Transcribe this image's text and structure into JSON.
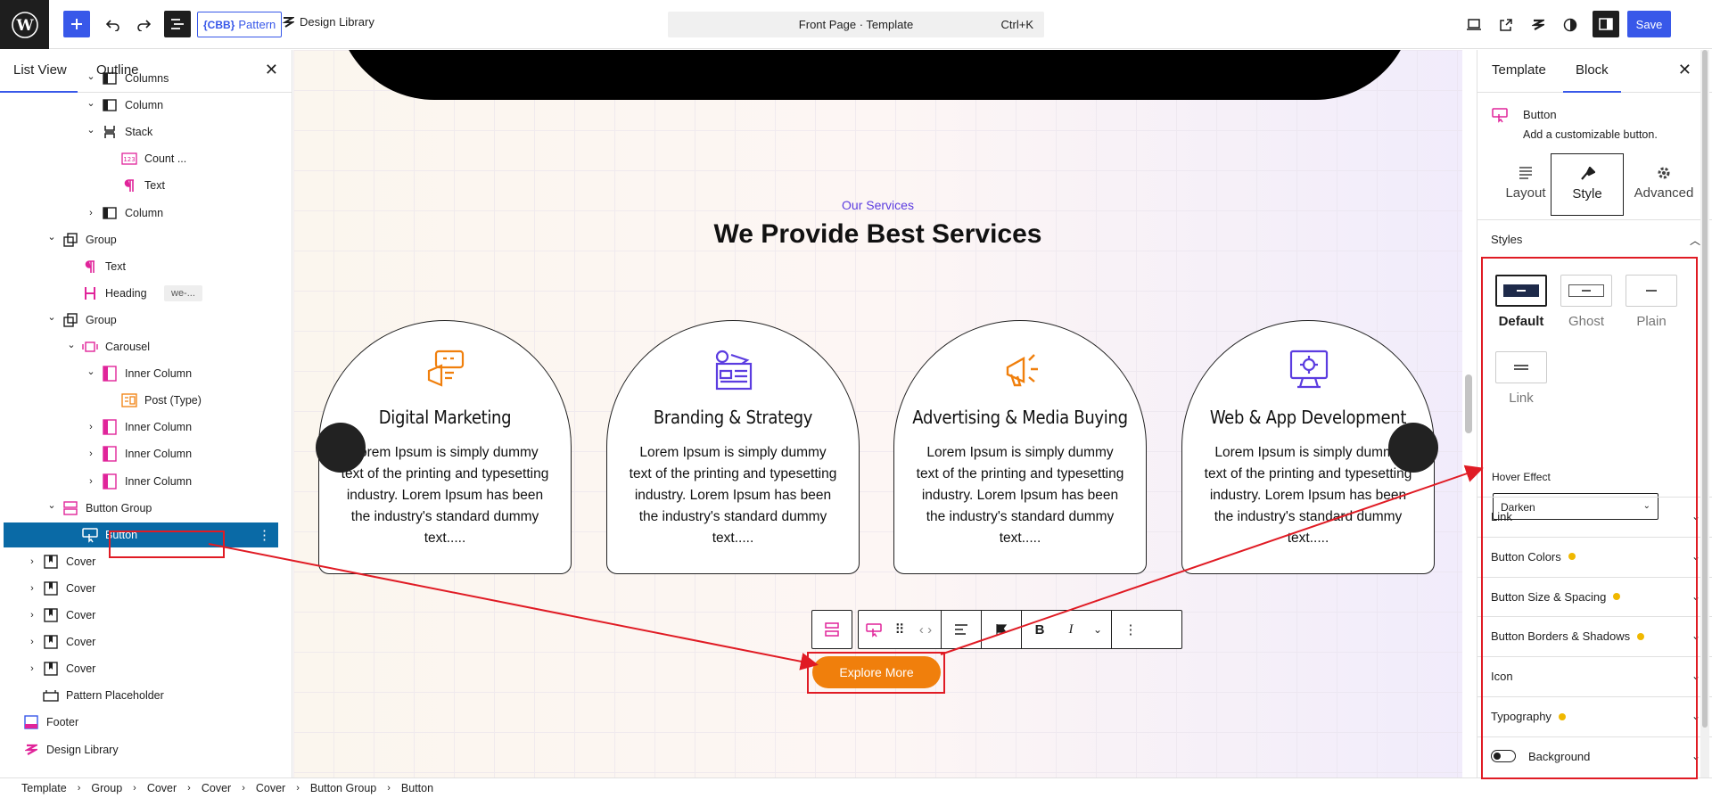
{
  "topbar": {
    "pattern_badge": "{CBB}",
    "pattern_label": "Pattern",
    "design_library": "Design Library",
    "command_title": "Front Page · Template",
    "command_shortcut": "Ctrl+K",
    "save_label": "Save"
  },
  "list_panel": {
    "tabs": [
      "List View",
      "Outline"
    ],
    "items": [
      {
        "label": "Columns",
        "chevron": "down"
      },
      {
        "label": "Column",
        "chevron": "down"
      },
      {
        "label": "Stack",
        "chevron": "down"
      },
      {
        "label": "Count ...",
        "chevron": ""
      },
      {
        "label": "Text",
        "chevron": ""
      },
      {
        "label": "Column",
        "chevron": "right"
      },
      {
        "label": "Group",
        "chevron": "down"
      },
      {
        "label": "Text",
        "chevron": ""
      },
      {
        "label": "Heading",
        "chevron": "",
        "badge": "we-..."
      },
      {
        "label": "Group",
        "chevron": "down"
      },
      {
        "label": "Carousel",
        "chevron": "down"
      },
      {
        "label": "Inner Column",
        "chevron": "down"
      },
      {
        "label": "Post (Type)",
        "chevron": ""
      },
      {
        "label": "Inner Column",
        "chevron": "right"
      },
      {
        "label": "Inner Column",
        "chevron": "right"
      },
      {
        "label": "Inner Column",
        "chevron": "right"
      },
      {
        "label": "Button Group",
        "chevron": "down"
      },
      {
        "label": "Button",
        "chevron": "",
        "selected": true
      },
      {
        "label": "Cover",
        "chevron": "right"
      },
      {
        "label": "Cover",
        "chevron": "right"
      },
      {
        "label": "Cover",
        "chevron": "right"
      },
      {
        "label": "Cover",
        "chevron": "right"
      },
      {
        "label": "Cover",
        "chevron": "right"
      },
      {
        "label": "Pattern Placeholder",
        "chevron": ""
      },
      {
        "label": "Footer",
        "chevron": ""
      },
      {
        "label": "Design Library",
        "chevron": ""
      }
    ]
  },
  "canvas": {
    "eyebrow": "Our Services",
    "title": "We Provide Best Services",
    "cards": [
      {
        "title": "Digital Marketing",
        "text": "Lorem Ipsum is simply dummy text of the printing and typesetting industry. Lorem Ipsum has been the industry's standard dummy text.....",
        "icon": "megaphone-chat-icon",
        "color": "#f07f0c"
      },
      {
        "title": "Branding & Strategy",
        "text": "Lorem Ipsum is simply dummy text of the printing and typesetting industry. Lorem Ipsum has been the industry's standard dummy text.....",
        "icon": "gear-layout-icon",
        "color": "#5b3ce0"
      },
      {
        "title": "Advertising & Media Buying",
        "text": "Lorem Ipsum is simply dummy text of the printing and typesetting industry. Lorem Ipsum has been the industry's standard dummy text.....",
        "icon": "megaphone-icon",
        "color": "#f07f0c"
      },
      {
        "title": "Web & App Development",
        "text": "Lorem Ipsum is simply dummy text of the printing and typesetting industry. Lorem Ipsum has been the industry's standard dummy text.....",
        "icon": "monitor-gear-icon",
        "color": "#5b3ce0"
      }
    ],
    "button_label": "Explore More"
  },
  "inspector": {
    "tabs": [
      "Template",
      "Block"
    ],
    "block_name": "Button",
    "block_desc": "Add a customizable button.",
    "style_tabs": [
      "Layout",
      "Style",
      "Advanced"
    ],
    "styles_title": "Styles",
    "style_options": [
      "Default",
      "Ghost",
      "Plain",
      "Link"
    ],
    "hover_label": "Hover Effect",
    "hover_value": "Darken",
    "sections": [
      {
        "label": "Link",
        "dot": false
      },
      {
        "label": "Button Colors",
        "dot": true
      },
      {
        "label": "Button Size & Spacing",
        "dot": true
      },
      {
        "label": "Button Borders & Shadows",
        "dot": true
      },
      {
        "label": "Icon",
        "dot": false
      },
      {
        "label": "Typography",
        "dot": true
      },
      {
        "label": "Background",
        "dot": false,
        "toggle": true
      }
    ]
  },
  "breadcrumb": [
    "Template",
    "Group",
    "Cover",
    "Cover",
    "Cover",
    "Button Group",
    "Button"
  ],
  "colors": {
    "accent": "#3858e9",
    "annotation": "#e01b24",
    "button": "#f07f0c",
    "purple": "#5b3ce0"
  }
}
